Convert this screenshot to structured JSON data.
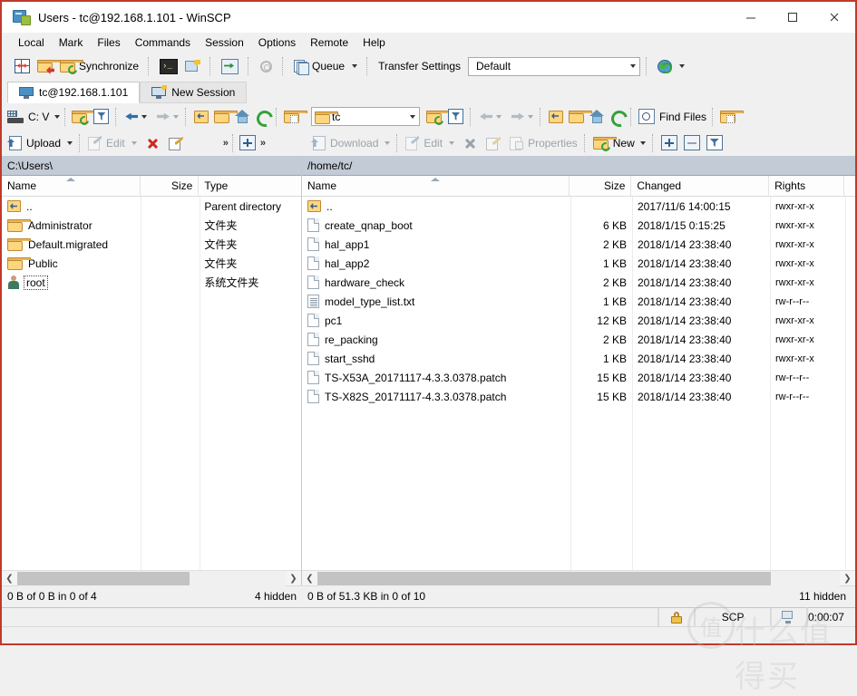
{
  "window": {
    "title": "Users - tc@192.168.1.101 - WinSCP",
    "minimize_label": "—",
    "maximize_label": "□",
    "close_label": "✕"
  },
  "menu": {
    "items": [
      "Local",
      "Mark",
      "Files",
      "Commands",
      "Session",
      "Options",
      "Remote",
      "Help"
    ]
  },
  "toolbar": {
    "synchronize_label": "Synchronize",
    "queue_label": "Queue",
    "transfer_settings_label": "Transfer Settings",
    "transfer_settings_value": "Default"
  },
  "tabs": [
    {
      "label": "tc@192.168.1.101",
      "active": true
    },
    {
      "label": "New Session",
      "active": false
    }
  ],
  "local_toolbar": {
    "path_value": "C: V",
    "upload_label": "Upload",
    "edit_label": "Edit",
    "overflow_label": "»"
  },
  "remote_toolbar": {
    "path_value": "tc",
    "find_files_label": "Find Files",
    "download_label": "Download",
    "edit_label": "Edit",
    "properties_label": "Properties",
    "new_label": "New"
  },
  "local_pane": {
    "path": "C:\\Users\\",
    "columns": [
      "Name",
      "Size",
      "Type"
    ],
    "rows": [
      {
        "icon": "parent-folder-icon",
        "name": "..",
        "size": "",
        "type": "Parent directory",
        "focused": false
      },
      {
        "icon": "folder-icon",
        "name": "Administrator",
        "size": "",
        "type": "文件夹",
        "focused": false
      },
      {
        "icon": "folder-icon",
        "name": "Default.migrated",
        "size": "",
        "type": "文件夹",
        "focused": false
      },
      {
        "icon": "folder-icon",
        "name": "Public",
        "size": "",
        "type": "文件夹",
        "focused": false
      },
      {
        "icon": "user-icon",
        "name": "root",
        "size": "",
        "type": "系统文件夹",
        "focused": true
      }
    ]
  },
  "remote_pane": {
    "path": "/home/tc/",
    "columns": [
      "Name",
      "Size",
      "Changed",
      "Rights"
    ],
    "rows": [
      {
        "icon": "parent-folder-icon",
        "name": "..",
        "size": "",
        "changed": "2017/11/6 14:00:15",
        "rights": "rwxr-xr-x"
      },
      {
        "icon": "file-icon",
        "name": "create_qnap_boot",
        "size": "6 KB",
        "changed": "2018/1/15 0:15:25",
        "rights": "rwxr-xr-x"
      },
      {
        "icon": "file-icon",
        "name": "hal_app1",
        "size": "2 KB",
        "changed": "2018/1/14 23:38:40",
        "rights": "rwxr-xr-x"
      },
      {
        "icon": "file-icon",
        "name": "hal_app2",
        "size": "1 KB",
        "changed": "2018/1/14 23:38:40",
        "rights": "rwxr-xr-x"
      },
      {
        "icon": "file-icon",
        "name": "hardware_check",
        "size": "2 KB",
        "changed": "2018/1/14 23:38:40",
        "rights": "rwxr-xr-x"
      },
      {
        "icon": "text-file-icon",
        "name": "model_type_list.txt",
        "size": "1 KB",
        "changed": "2018/1/14 23:38:40",
        "rights": "rw-r--r--"
      },
      {
        "icon": "file-icon",
        "name": "pc1",
        "size": "12 KB",
        "changed": "2018/1/14 23:38:40",
        "rights": "rwxr-xr-x"
      },
      {
        "icon": "file-icon",
        "name": "re_packing",
        "size": "2 KB",
        "changed": "2018/1/14 23:38:40",
        "rights": "rwxr-xr-x"
      },
      {
        "icon": "file-icon",
        "name": "start_sshd",
        "size": "1 KB",
        "changed": "2018/1/14 23:38:40",
        "rights": "rwxr-xr-x"
      },
      {
        "icon": "file-icon",
        "name": "TS-X53A_20171117-4.3.3.0378.patch",
        "size": "15 KB",
        "changed": "2018/1/14 23:38:40",
        "rights": "rw-r--r--"
      },
      {
        "icon": "file-icon",
        "name": "TS-X82S_20171117-4.3.3.0378.patch",
        "size": "15 KB",
        "changed": "2018/1/14 23:38:40",
        "rights": "rw-r--r--"
      }
    ]
  },
  "status": {
    "local_selection": "0 B of 0 B in 0 of 4",
    "local_hidden": "4 hidden",
    "remote_selection": "0 B of 51.3 KB in 0 of 10",
    "remote_hidden": "11 hidden",
    "protocol": "SCP",
    "elapsed": "0:00:07"
  },
  "watermark": {
    "circle_char": "值",
    "text": "什么值得买"
  }
}
